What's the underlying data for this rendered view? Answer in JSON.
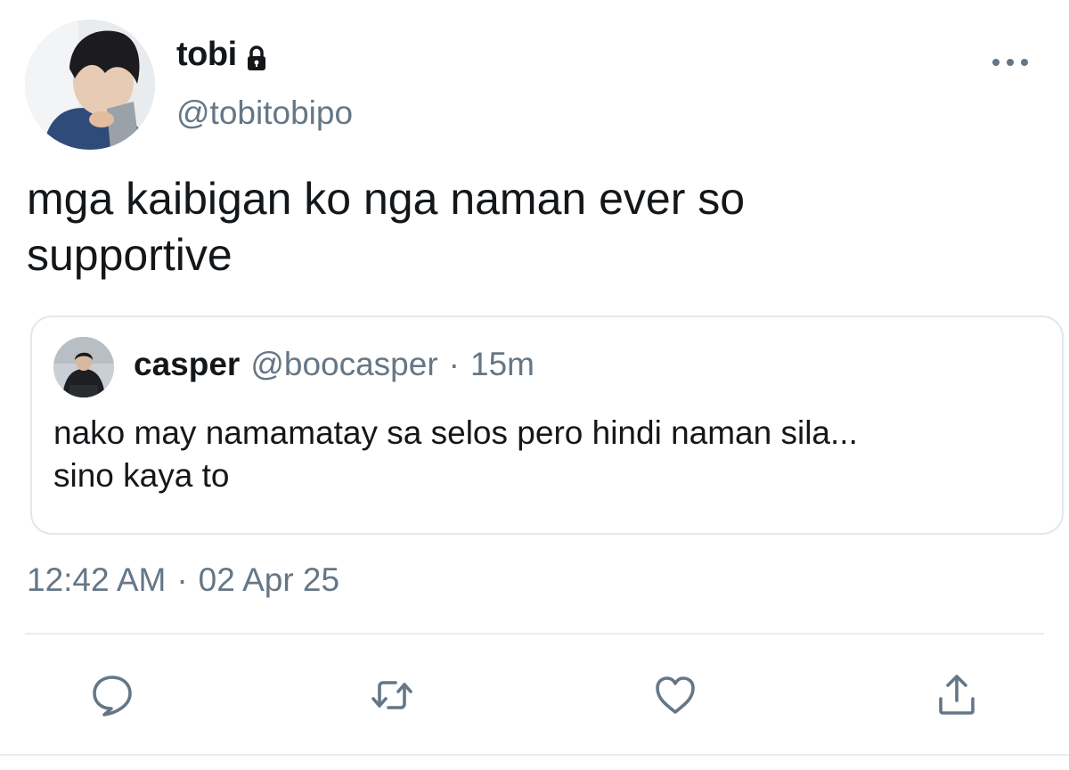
{
  "author": {
    "display_name": "tobi",
    "handle": "@tobitobipo",
    "protected_icon": "lock-icon"
  },
  "menu": {
    "icon": "more-horizontal-icon"
  },
  "tweet": {
    "text": "mga kaibigan ko nga naman ever so\nsupportive"
  },
  "quote": {
    "display_name": "casper",
    "handle": "@boocasper",
    "separator": "·",
    "time": "15m",
    "text": "nako may namamatay sa selos pero hindi naman sila...\nsino kaya to"
  },
  "timestamp": {
    "time": "12:42 AM",
    "separator": "·",
    "date": "02 Apr 25"
  },
  "actions": [
    {
      "icon": "reply-icon"
    },
    {
      "icon": "retweet-icon"
    },
    {
      "icon": "like-icon"
    },
    {
      "icon": "share-icon"
    }
  ],
  "colors": {
    "text_primary": "#14171a",
    "text_secondary": "#657786",
    "border": "#e1e8ed",
    "icon": "#657786"
  }
}
